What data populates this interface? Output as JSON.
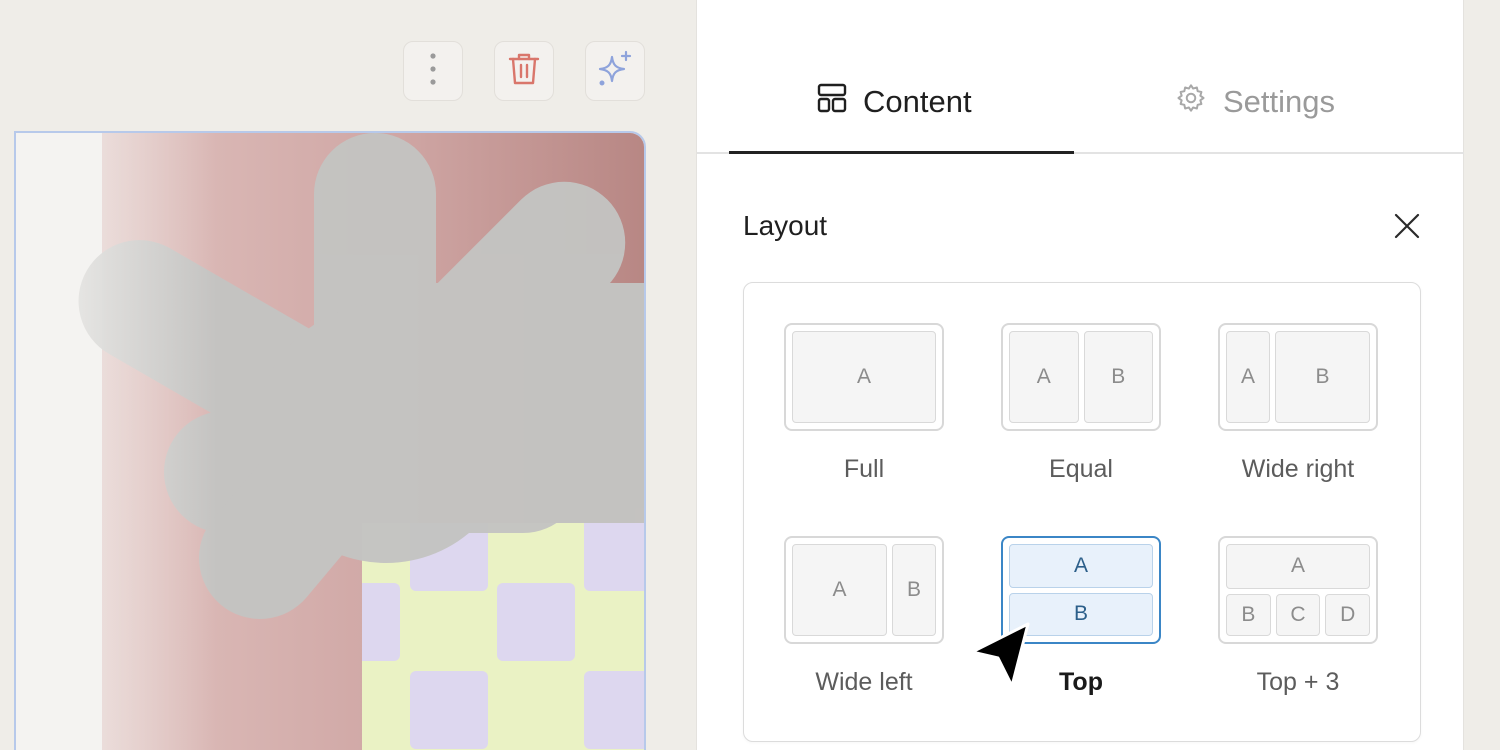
{
  "toolbar": {
    "more_icon": "vertical-dots-icon",
    "delete_icon": "trash-icon",
    "ai_icon": "sparkle-icon",
    "delete_color": "#d9766b",
    "ai_color": "#8ea3db"
  },
  "tabs": [
    {
      "label": "Content",
      "icon": "layout-icon",
      "active": true
    },
    {
      "label": "Settings",
      "icon": "gear-icon",
      "active": false
    }
  ],
  "layout_section": {
    "title": "Layout",
    "close_icon": "close-icon",
    "options": [
      {
        "label": "Full",
        "cells": [
          "A"
        ]
      },
      {
        "label": "Equal",
        "cells": [
          "A",
          "B"
        ]
      },
      {
        "label": "Wide right",
        "cells": [
          "A",
          "B"
        ]
      },
      {
        "label": "Wide left",
        "cells": [
          "A",
          "B"
        ]
      },
      {
        "label": "Top",
        "cells": [
          "A",
          "B"
        ],
        "selected": true
      },
      {
        "label": "Top + 3",
        "cells": [
          "A",
          "B",
          "C",
          "D"
        ]
      }
    ]
  },
  "colors": {
    "selected_border": "#3b86c6",
    "selected_fill": "#e8f1fb",
    "canvas_selection": "#b7c9ea"
  }
}
